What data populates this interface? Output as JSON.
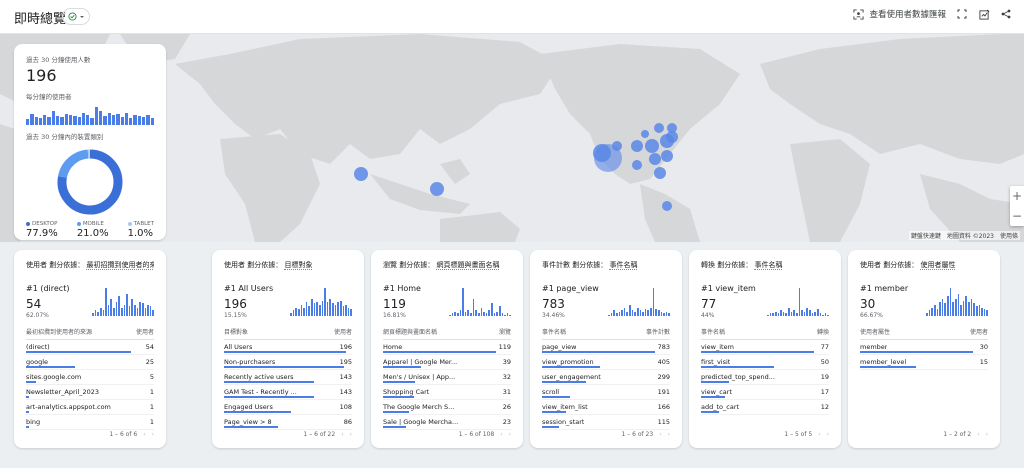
{
  "header": {
    "title": "即時總覽",
    "view_snapshot": "查看使用者數據匯報"
  },
  "map": {
    "attribution": "鍵盤快速鍵　地圖資料 ©2023　使用條"
  },
  "summary": {
    "users_label": "過去 30 分鐘使用人數",
    "users_value": "196",
    "per_minute_label": "每分鐘的使用者",
    "device_label": "過去 30 分鐘內的裝置類別",
    "per_minute_bars": [
      0.3,
      0.55,
      0.4,
      0.35,
      0.5,
      0.4,
      0.7,
      0.45,
      0.4,
      0.55,
      0.5,
      0.45,
      0.4,
      0.6,
      0.5,
      0.35,
      0.9,
      0.7,
      0.45,
      0.6,
      0.5,
      0.55,
      0.4,
      0.6,
      0.35,
      0.5,
      0.45,
      0.4,
      0.5,
      0.35
    ],
    "devices": [
      {
        "label": "DESKTOP",
        "value": "77.9%",
        "fraction": 0.779,
        "color": "#3b6fd8"
      },
      {
        "label": "MOBILE",
        "value": "21.0%",
        "fraction": 0.21,
        "color": "#5d9cf1"
      },
      {
        "label": "TABLET",
        "value": "1.0%",
        "fraction": 0.01,
        "color": "#a8c7fa"
      }
    ]
  },
  "cards": [
    {
      "title_prefix": "使用者 劃分依據：",
      "title_dim": "最初招攬到使用者的來源",
      "top_name": "#1 (direct)",
      "top_value": "54",
      "top_pct": "62.07%",
      "col1": "最初招攬到使用者的來源",
      "col2": "使用者",
      "rows": [
        {
          "name": "(direct)",
          "value": "54",
          "frac": 0.82
        },
        {
          "name": "google",
          "value": "25",
          "frac": 0.38
        },
        {
          "name": "sites.google.com",
          "value": "5",
          "frac": 0.08
        },
        {
          "name": "Newsletter_April_2023",
          "value": "1",
          "frac": 0.02
        },
        {
          "name": "art-analytics.appspot.com",
          "value": "1",
          "frac": 0.02
        },
        {
          "name": "bing",
          "value": "1",
          "frac": 0.02
        }
      ],
      "pager": "1 – 6 of 6",
      "spark": [
        0.1,
        0.2,
        0.15,
        0.3,
        0.2,
        1.0,
        0.4,
        0.6,
        0.3,
        0.5,
        0.7,
        0.3,
        0.4,
        0.8,
        0.35,
        0.6,
        0.4,
        0.3,
        0.5,
        0.45,
        0.3,
        0.4,
        0.35,
        0.2
      ]
    },
    {
      "title_prefix": "使用者 劃分依據：",
      "title_dim": "目標對象",
      "top_name": "#1 All Users",
      "top_value": "196",
      "top_pct": "15.15%",
      "col1": "目標對象",
      "col2": "使用者",
      "rows": [
        {
          "name": "All Users",
          "value": "196",
          "frac": 0.95
        },
        {
          "name": "Non-purchasers",
          "value": "195",
          "frac": 0.94
        },
        {
          "name": "Recently active users",
          "value": "143",
          "frac": 0.7
        },
        {
          "name": "GAM Test - Recently ...",
          "value": "143",
          "frac": 0.7
        },
        {
          "name": "Engaged Users",
          "value": "108",
          "frac": 0.52
        },
        {
          "name": "Page_view > 8",
          "value": "86",
          "frac": 0.42
        }
      ],
      "pager": "1 – 6 of 22",
      "spark": [
        0.1,
        0.2,
        0.3,
        0.25,
        0.4,
        0.3,
        0.5,
        0.35,
        0.6,
        0.45,
        0.5,
        0.4,
        0.55,
        1.0,
        0.5,
        0.6,
        0.45,
        0.4,
        0.5,
        0.55,
        0.35,
        0.4,
        0.3,
        0.25
      ]
    },
    {
      "title_prefix": "瀏覽 劃分依據：",
      "title_dim": "網頁標題與畫面名稱",
      "top_name": "#1 Home",
      "top_value": "119",
      "top_pct": "16.81%",
      "col1": "網頁標題與畫面名稱",
      "col2": "瀏覽",
      "rows": [
        {
          "name": "Home",
          "value": "119",
          "frac": 0.88
        },
        {
          "name": "Apparel | Google Mer...",
          "value": "39",
          "frac": 0.3
        },
        {
          "name": "Men's / Unisex | App...",
          "value": "32",
          "frac": 0.25
        },
        {
          "name": "Shopping Cart",
          "value": "31",
          "frac": 0.24
        },
        {
          "name": "The Google Merch S...",
          "value": "26",
          "frac": 0.2
        },
        {
          "name": "Sale | Google Mercha...",
          "value": "23",
          "frac": 0.18
        }
      ],
      "pager": "1 – 6 of 108",
      "spark": [
        0.05,
        0.1,
        0.15,
        0.1,
        0.2,
        1.0,
        0.15,
        0.2,
        0.1,
        0.6,
        0.2,
        0.1,
        0.3,
        0.15,
        0.1,
        0.2,
        0.45,
        0.1,
        0.15,
        0.35,
        0.1,
        0.05,
        0.1,
        0.05
      ]
    },
    {
      "title_prefix": "事件計數 劃分依據：",
      "title_dim": "事件名稱",
      "top_name": "#1 page_view",
      "top_value": "783",
      "top_pct": "34.46%",
      "col1": "事件名稱",
      "col2": "事件計數",
      "rows": [
        {
          "name": "page_view",
          "value": "783",
          "frac": 0.88
        },
        {
          "name": "view_promotion",
          "value": "405",
          "frac": 0.45
        },
        {
          "name": "user_engagement",
          "value": "299",
          "frac": 0.34
        },
        {
          "name": "scroll",
          "value": "191",
          "frac": 0.22
        },
        {
          "name": "view_item_list",
          "value": "166",
          "frac": 0.19
        },
        {
          "name": "session_start",
          "value": "115",
          "frac": 0.13
        }
      ],
      "pager": "1 – 6 of 23",
      "spark": [
        0.05,
        0.1,
        0.2,
        0.1,
        0.15,
        0.2,
        0.3,
        0.15,
        0.4,
        0.2,
        0.15,
        0.3,
        0.2,
        0.15,
        0.25,
        0.2,
        0.3,
        1.0,
        0.25,
        0.2,
        0.15,
        0.1,
        0.15,
        0.1
      ]
    },
    {
      "title_prefix": "轉換 劃分依據：",
      "title_dim": "事件名稱",
      "top_name": "#1 view_item",
      "top_value": "77",
      "top_pct": "44%",
      "col1": "事件名稱",
      "col2": "轉換",
      "rows": [
        {
          "name": "view_item",
          "value": "77",
          "frac": 0.88
        },
        {
          "name": "first_visit",
          "value": "50",
          "frac": 0.57
        },
        {
          "name": "predicted_top_spend...",
          "value": "19",
          "frac": 0.22
        },
        {
          "name": "view_cart",
          "value": "17",
          "frac": 0.19
        },
        {
          "name": "add_to_cart",
          "value": "12",
          "frac": 0.14
        }
      ],
      "pager": "1 – 5 of 5",
      "spark": [
        0.05,
        0.1,
        0.1,
        0.15,
        0.1,
        0.2,
        0.15,
        0.1,
        0.3,
        0.15,
        0.2,
        0.1,
        1.0,
        0.2,
        0.15,
        0.3,
        0.2,
        0.1,
        0.15,
        0.25,
        0.1,
        0.05,
        0.1,
        0.05
      ]
    },
    {
      "title_prefix": "使用者 劃分依據：",
      "title_dim": "使用者屬性",
      "top_name": "#1 member",
      "top_value": "30",
      "top_pct": "66.67%",
      "col1": "使用者屬性",
      "col2": "使用者",
      "rows": [
        {
          "name": "member",
          "value": "30",
          "frac": 0.88
        },
        {
          "name": "member_level",
          "value": "15",
          "frac": 0.44
        }
      ],
      "pager": "1 – 2 of 2",
      "spark": [
        0.1,
        0.2,
        0.3,
        0.4,
        0.25,
        0.5,
        0.6,
        0.45,
        0.7,
        1.0,
        0.5,
        0.6,
        0.8,
        0.4,
        0.55,
        0.7,
        0.5,
        0.6,
        0.45,
        0.35,
        0.4,
        0.3,
        0.25,
        0.2
      ]
    }
  ],
  "colors": {
    "accent": "#4a7ee6",
    "map_land": "#d8d9db",
    "map_water": "#e8eaed",
    "map_dot": "#5a87e6"
  }
}
